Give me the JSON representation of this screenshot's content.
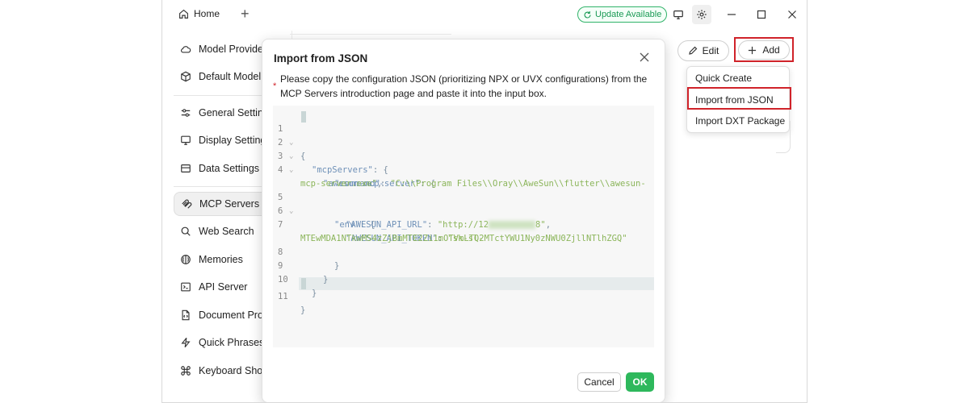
{
  "titlebar": {
    "home_tab": "Home",
    "update_label": "Update Available"
  },
  "sidebar": {
    "items": [
      {
        "label": "Model Provide",
        "icon": "cloud-icon"
      },
      {
        "label": "Default Model",
        "icon": "cube-icon"
      },
      {
        "label": "General Settin",
        "icon": "sliders-icon"
      },
      {
        "label": "Display Setting",
        "icon": "monitor-icon"
      },
      {
        "label": "Data Settings",
        "icon": "database-icon"
      },
      {
        "label": "MCP Servers",
        "icon": "mcp-icon"
      },
      {
        "label": "Web Search",
        "icon": "search-icon"
      },
      {
        "label": "Memories",
        "icon": "brain-icon"
      },
      {
        "label": "API Server",
        "icon": "server-icon"
      },
      {
        "label": "Document Pro",
        "icon": "document-icon"
      },
      {
        "label": "Quick Phrases",
        "icon": "zap-icon"
      },
      {
        "label": "Keyboard Shor",
        "icon": "command-icon"
      }
    ],
    "active_item": "MCP Servers"
  },
  "toolbar": {
    "edit_label": "Edit",
    "add_label": "Add"
  },
  "add_menu": {
    "items": [
      "Quick Create",
      "Import from JSON",
      "Import DXT Package"
    ],
    "highlighted": "Import from JSON"
  },
  "dialog": {
    "title": "Import from JSON",
    "required_mark": "*",
    "description": "Please copy the configuration JSON (prioritizing NPX or UVX configurations) from the MCP Servers introduction page and paste it into the input box.",
    "code_lines": [
      {
        "n": "1",
        "fold": true,
        "text": "{"
      },
      {
        "n": "2",
        "fold": true,
        "key": "\"mcpServers\"",
        "rest": ": {"
      },
      {
        "n": "3",
        "fold": true,
        "key": "\"awesun-mcp-server\"",
        "rest": ": {"
      },
      {
        "n": "4",
        "fold": false,
        "key": "\"command\"",
        "value": "\"C:\\\\Program Files\\\\Oray\\\\AweSun\\\\flutter\\\\awesun-"
      },
      {
        "n": "",
        "fold": false,
        "value": "mcp-server.exe\"",
        "rest": ","
      },
      {
        "n": "5",
        "fold": true,
        "key": "\"env\"",
        "rest": ": {"
      },
      {
        "n": "6",
        "fold": false,
        "key": "\"AWESUN_API_URL\"",
        "value_a": "\"http://12",
        "value_b": "8\"",
        "rest": ","
      },
      {
        "n": "7",
        "fold": false,
        "key": "\"AWESUN_API_TOKEN\"",
        "value": "\"sk-sl-"
      },
      {
        "n": "",
        "fold": false,
        "value": "MTEwMDA1NTkwMS4zZjBmMTE2Zi1mOTVmLTQ2MTctYWU1Ny0zNWU0ZjllNTlhZGQ\""
      },
      {
        "n": "8",
        "fold": false,
        "text": "}"
      },
      {
        "n": "9",
        "fold": false,
        "text": "}"
      },
      {
        "n": "10",
        "fold": false,
        "text": "}"
      },
      {
        "n": "11",
        "fold": false,
        "text": "}"
      }
    ],
    "cancel_label": "Cancel",
    "ok_label": "OK"
  },
  "colors": {
    "accent_green": "#2eb85c",
    "highlight_red": "#d0232a"
  }
}
